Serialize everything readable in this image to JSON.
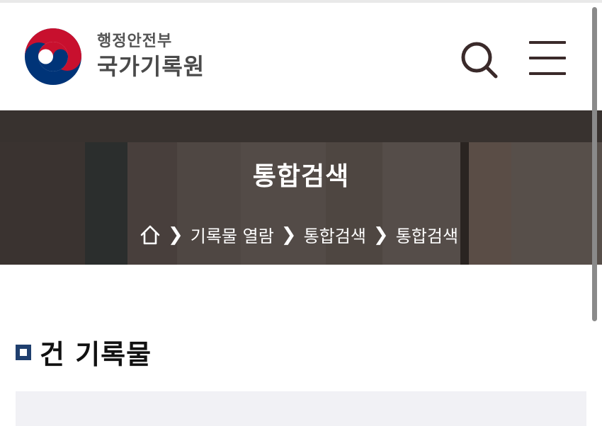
{
  "header": {
    "ministry_name": "행정안전부",
    "org_name": "국가기록원",
    "logo_icon": "korea-government-emblem-icon",
    "search_icon": "search-icon",
    "menu_icon": "hamburger-menu-icon"
  },
  "banner": {
    "title": "통합검색",
    "breadcrumb": {
      "home_icon": "home-icon",
      "items": [
        "기록물 열람",
        "통합검색",
        "통합검색"
      ],
      "separator_icon": "chevron-right-icon"
    }
  },
  "content": {
    "section_title": "건 기록물",
    "result_text": "",
    "result_bg": "#f1f1f5"
  },
  "colors": {
    "accent": "#1f3f6e",
    "emblem_red": "#c8102e",
    "emblem_blue": "#003478",
    "header_icon": "#3a2a2a"
  }
}
